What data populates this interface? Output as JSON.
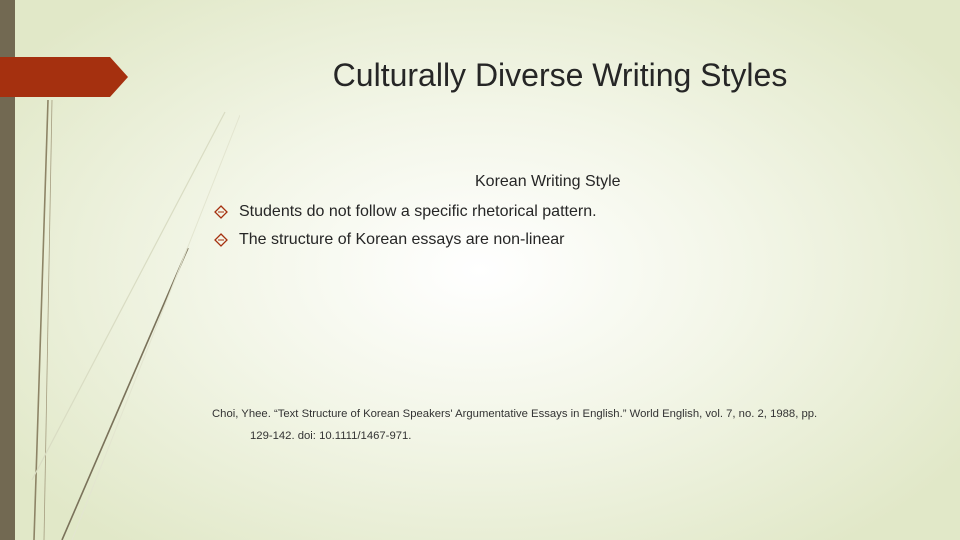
{
  "slide": {
    "title": "Culturally Diverse Writing Styles",
    "subheading": "Korean Writing Style",
    "bullets": [
      "Students do not follow a specific rhetorical pattern.",
      "The structure of Korean essays are non-linear"
    ],
    "citation": {
      "line1": "Choi, Yhee. “Text Structure of Korean Speakers' Argumentative Essays in English.” World English, vol. 7, no. 2, 1988, pp.",
      "line2": "129-142. doi: 10.1111/1467-971."
    }
  },
  "theme": {
    "accent": "#a5300f",
    "sidebar": "#726952",
    "bullet_icon": "diamond-outline-icon",
    "text": "#262626"
  }
}
